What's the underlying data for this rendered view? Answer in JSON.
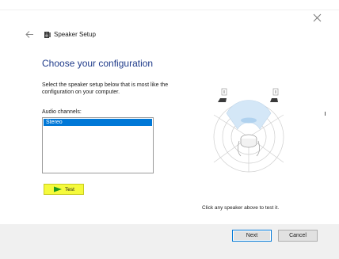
{
  "window": {
    "title": "Speaker Setup",
    "close_icon": "close-icon",
    "back_icon": "back-arrow-icon",
    "app_icon": "speaker-icon"
  },
  "main": {
    "heading": "Choose your configuration",
    "description": "Select the speaker setup below that is most like the configuration on your computer.",
    "channels_label": "Audio channels:",
    "channels": [
      {
        "label": "Stereo",
        "selected": true
      }
    ],
    "test_label": "Test",
    "test_icon": "play-icon",
    "hint": "Click any speaker above to test it.",
    "speakers": [
      {
        "name": "L"
      },
      {
        "name": "R"
      }
    ]
  },
  "footer": {
    "next_label": "Next",
    "cancel_label": "Cancel"
  },
  "colors": {
    "accent": "#0078d7",
    "heading": "#1f3b8a",
    "highlight": "#f5fa3c"
  }
}
